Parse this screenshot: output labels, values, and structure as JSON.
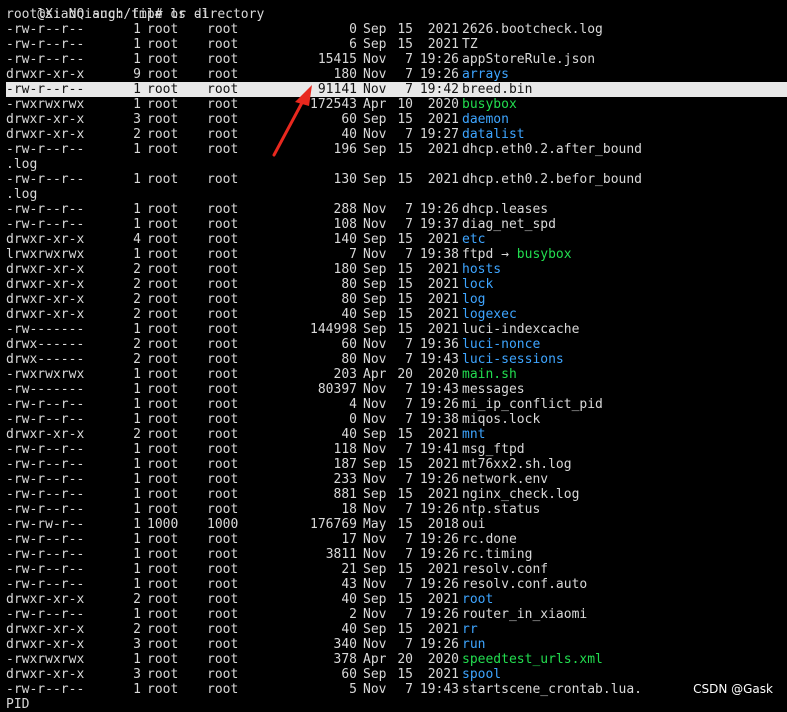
{
  "terminal": {
    "error_line": {
      "prefix": "ls: ",
      "text": "No such file or directory"
    },
    "prompt": "root@XiaoQiang:/tmp# ls -l",
    "bottom_partial": "PID",
    "rows": [
      {
        "perm": "-rw-r--r--",
        "links": "1",
        "owner": "root",
        "group": "root",
        "size": "0",
        "mon": "Sep",
        "day": "15",
        "time": "2021",
        "name": "2626.bootcheck.log",
        "kind": "file"
      },
      {
        "perm": "-rw-r--r--",
        "links": "1",
        "owner": "root",
        "group": "root",
        "size": "6",
        "mon": "Sep",
        "day": "15",
        "time": "2021",
        "name": "TZ",
        "kind": "file"
      },
      {
        "perm": "-rw-r--r--",
        "links": "1",
        "owner": "root",
        "group": "root",
        "size": "15415",
        "mon": "Nov",
        "day": "7",
        "time": "19:26",
        "name": "appStoreRule.json",
        "kind": "file"
      },
      {
        "perm": "drwxr-xr-x",
        "links": "9",
        "owner": "root",
        "group": "root",
        "size": "180",
        "mon": "Nov",
        "day": "7",
        "time": "19:26",
        "name": "arrays",
        "kind": "dir"
      },
      {
        "perm": "-rw-r--r--",
        "links": "1",
        "owner": "root",
        "group": "root",
        "size": "91141",
        "mon": "Nov",
        "day": "7",
        "time": "19:42",
        "name": "breed.bin",
        "kind": "file",
        "highlight": true
      },
      {
        "perm": "-rwxrwxrwx",
        "links": "1",
        "owner": "root",
        "group": "root",
        "size": "172543",
        "mon": "Apr",
        "day": "10",
        "time": "2020",
        "name": "busybox",
        "kind": "exec"
      },
      {
        "perm": "drwxr-xr-x",
        "links": "3",
        "owner": "root",
        "group": "root",
        "size": "60",
        "mon": "Sep",
        "day": "15",
        "time": "2021",
        "name": "daemon",
        "kind": "dir"
      },
      {
        "perm": "drwxr-xr-x",
        "links": "2",
        "owner": "root",
        "group": "root",
        "size": "40",
        "mon": "Nov",
        "day": "7",
        "time": "19:27",
        "name": "datalist",
        "kind": "dir"
      },
      {
        "perm": "-rw-r--r--",
        "links": "1",
        "owner": "root",
        "group": "root",
        "size": "196",
        "mon": "Sep",
        "day": "15",
        "time": "2021",
        "name": "dhcp.eth0.2.after_bound",
        "kind": "file"
      },
      {
        "wrap": ".log"
      },
      {
        "perm": "-rw-r--r--",
        "links": "1",
        "owner": "root",
        "group": "root",
        "size": "130",
        "mon": "Sep",
        "day": "15",
        "time": "2021",
        "name": "dhcp.eth0.2.befor_bound",
        "kind": "file"
      },
      {
        "wrap": ".log"
      },
      {
        "perm": "-rw-r--r--",
        "links": "1",
        "owner": "root",
        "group": "root",
        "size": "288",
        "mon": "Nov",
        "day": "7",
        "time": "19:26",
        "name": "dhcp.leases",
        "kind": "file"
      },
      {
        "perm": "-rw-r--r--",
        "links": "1",
        "owner": "root",
        "group": "root",
        "size": "108",
        "mon": "Nov",
        "day": "7",
        "time": "19:37",
        "name": "diag_net_spd",
        "kind": "file"
      },
      {
        "perm": "drwxr-xr-x",
        "links": "4",
        "owner": "root",
        "group": "root",
        "size": "140",
        "mon": "Sep",
        "day": "15",
        "time": "2021",
        "name": "etc",
        "kind": "dir"
      },
      {
        "perm": "lrwxrwxrwx",
        "links": "1",
        "owner": "root",
        "group": "root",
        "size": "7",
        "mon": "Nov",
        "day": "7",
        "time": "19:38",
        "name": "ftpd",
        "kind": "file",
        "arrow": " → ",
        "target": "busybox"
      },
      {
        "perm": "drwxr-xr-x",
        "links": "2",
        "owner": "root",
        "group": "root",
        "size": "180",
        "mon": "Sep",
        "day": "15",
        "time": "2021",
        "name": "hosts",
        "kind": "dir"
      },
      {
        "perm": "drwxr-xr-x",
        "links": "2",
        "owner": "root",
        "group": "root",
        "size": "80",
        "mon": "Sep",
        "day": "15",
        "time": "2021",
        "name": "lock",
        "kind": "dir"
      },
      {
        "perm": "drwxr-xr-x",
        "links": "2",
        "owner": "root",
        "group": "root",
        "size": "80",
        "mon": "Sep",
        "day": "15",
        "time": "2021",
        "name": "log",
        "kind": "dir"
      },
      {
        "perm": "drwxr-xr-x",
        "links": "2",
        "owner": "root",
        "group": "root",
        "size": "40",
        "mon": "Sep",
        "day": "15",
        "time": "2021",
        "name": "logexec",
        "kind": "dir"
      },
      {
        "perm": "-rw-------",
        "links": "1",
        "owner": "root",
        "group": "root",
        "size": "144998",
        "mon": "Sep",
        "day": "15",
        "time": "2021",
        "name": "luci-indexcache",
        "kind": "file"
      },
      {
        "perm": "drwx------",
        "links": "2",
        "owner": "root",
        "group": "root",
        "size": "60",
        "mon": "Nov",
        "day": "7",
        "time": "19:36",
        "name": "luci-nonce",
        "kind": "dir"
      },
      {
        "perm": "drwx------",
        "links": "2",
        "owner": "root",
        "group": "root",
        "size": "80",
        "mon": "Nov",
        "day": "7",
        "time": "19:43",
        "name": "luci-sessions",
        "kind": "dir"
      },
      {
        "perm": "-rwxrwxrwx",
        "links": "1",
        "owner": "root",
        "group": "root",
        "size": "203",
        "mon": "Apr",
        "day": "20",
        "time": "2020",
        "name": "main.sh",
        "kind": "exec"
      },
      {
        "perm": "-rw-------",
        "links": "1",
        "owner": "root",
        "group": "root",
        "size": "80397",
        "mon": "Nov",
        "day": "7",
        "time": "19:43",
        "name": "messages",
        "kind": "file"
      },
      {
        "perm": "-rw-r--r--",
        "links": "1",
        "owner": "root",
        "group": "root",
        "size": "4",
        "mon": "Nov",
        "day": "7",
        "time": "19:26",
        "name": "mi_ip_conflict_pid",
        "kind": "file"
      },
      {
        "perm": "-rw-r--r--",
        "links": "1",
        "owner": "root",
        "group": "root",
        "size": "0",
        "mon": "Nov",
        "day": "7",
        "time": "19:38",
        "name": "miqos.lock",
        "kind": "file"
      },
      {
        "perm": "drwxr-xr-x",
        "links": "2",
        "owner": "root",
        "group": "root",
        "size": "40",
        "mon": "Sep",
        "day": "15",
        "time": "2021",
        "name": "mnt",
        "kind": "dir"
      },
      {
        "perm": "-rw-r--r--",
        "links": "1",
        "owner": "root",
        "group": "root",
        "size": "118",
        "mon": "Nov",
        "day": "7",
        "time": "19:41",
        "name": "msg_ftpd",
        "kind": "file"
      },
      {
        "perm": "-rw-r--r--",
        "links": "1",
        "owner": "root",
        "group": "root",
        "size": "187",
        "mon": "Sep",
        "day": "15",
        "time": "2021",
        "name": "mt76xx2.sh.log",
        "kind": "file"
      },
      {
        "perm": "-rw-r--r--",
        "links": "1",
        "owner": "root",
        "group": "root",
        "size": "233",
        "mon": "Nov",
        "day": "7",
        "time": "19:26",
        "name": "network.env",
        "kind": "file"
      },
      {
        "perm": "-rw-r--r--",
        "links": "1",
        "owner": "root",
        "group": "root",
        "size": "881",
        "mon": "Sep",
        "day": "15",
        "time": "2021",
        "name": "nginx_check.log",
        "kind": "file"
      },
      {
        "perm": "-rw-r--r--",
        "links": "1",
        "owner": "root",
        "group": "root",
        "size": "18",
        "mon": "Nov",
        "day": "7",
        "time": "19:26",
        "name": "ntp.status",
        "kind": "file"
      },
      {
        "perm": "-rw-rw-r--",
        "links": "1",
        "owner": "1000",
        "group": "1000",
        "size": "176769",
        "mon": "May",
        "day": "15",
        "time": "2018",
        "name": "oui",
        "kind": "file"
      },
      {
        "perm": "-rw-r--r--",
        "links": "1",
        "owner": "root",
        "group": "root",
        "size": "17",
        "mon": "Nov",
        "day": "7",
        "time": "19:26",
        "name": "rc.done",
        "kind": "file"
      },
      {
        "perm": "-rw-r--r--",
        "links": "1",
        "owner": "root",
        "group": "root",
        "size": "3811",
        "mon": "Nov",
        "day": "7",
        "time": "19:26",
        "name": "rc.timing",
        "kind": "file"
      },
      {
        "perm": "-rw-r--r--",
        "links": "1",
        "owner": "root",
        "group": "root",
        "size": "21",
        "mon": "Sep",
        "day": "15",
        "time": "2021",
        "name": "resolv.conf",
        "kind": "file"
      },
      {
        "perm": "-rw-r--r--",
        "links": "1",
        "owner": "root",
        "group": "root",
        "size": "43",
        "mon": "Nov",
        "day": "7",
        "time": "19:26",
        "name": "resolv.conf.auto",
        "kind": "file"
      },
      {
        "perm": "drwxr-xr-x",
        "links": "2",
        "owner": "root",
        "group": "root",
        "size": "40",
        "mon": "Sep",
        "day": "15",
        "time": "2021",
        "name": "root",
        "kind": "dir"
      },
      {
        "perm": "-rw-r--r--",
        "links": "1",
        "owner": "root",
        "group": "root",
        "size": "2",
        "mon": "Nov",
        "day": "7",
        "time": "19:26",
        "name": "router_in_xiaomi",
        "kind": "file"
      },
      {
        "perm": "drwxr-xr-x",
        "links": "2",
        "owner": "root",
        "group": "root",
        "size": "40",
        "mon": "Sep",
        "day": "15",
        "time": "2021",
        "name": "rr",
        "kind": "dir"
      },
      {
        "perm": "drwxr-xr-x",
        "links": "3",
        "owner": "root",
        "group": "root",
        "size": "340",
        "mon": "Nov",
        "day": "7",
        "time": "19:26",
        "name": "run",
        "kind": "dir"
      },
      {
        "perm": "-rwxrwxrwx",
        "links": "1",
        "owner": "root",
        "group": "root",
        "size": "378",
        "mon": "Apr",
        "day": "20",
        "time": "2020",
        "name": "speedtest_urls.xml",
        "kind": "exec"
      },
      {
        "perm": "drwxr-xr-x",
        "links": "3",
        "owner": "root",
        "group": "root",
        "size": "60",
        "mon": "Sep",
        "day": "15",
        "time": "2021",
        "name": "spool",
        "kind": "dir"
      },
      {
        "perm": "-rw-r--r--",
        "links": "1",
        "owner": "root",
        "group": "root",
        "size": "5",
        "mon": "Nov",
        "day": "7",
        "time": "19:43",
        "name": "startscene_crontab.lua.",
        "kind": "file"
      }
    ]
  },
  "watermark": "CSDN @Gask",
  "colors": {
    "background": "#000000",
    "text": "#d9d9d9",
    "directory": "#3ea5ff",
    "executable": "#22dd4f",
    "highlight_bg": "#e8e8e8",
    "annotation_arrow": "#e8281e"
  }
}
